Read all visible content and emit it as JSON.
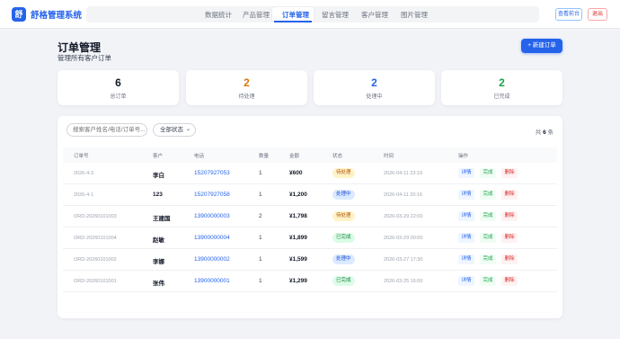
{
  "app": {
    "logo": "舒",
    "title": "舒格管理系统"
  },
  "nav": {
    "tabs": [
      "数据统计",
      "产品管理",
      "订单管理",
      "留言管理",
      "客户管理",
      "图片管理"
    ],
    "active_index": 2
  },
  "header_buttons": {
    "frontend": "查看前台",
    "logout": "退出"
  },
  "page": {
    "title": "订单管理",
    "subtitle": "管理所有客户订单",
    "new_button": "+ 新建订单"
  },
  "stats": [
    {
      "value": "6",
      "label": "总订单",
      "color": "#111827"
    },
    {
      "value": "2",
      "label": "待处理",
      "color": "#d97706"
    },
    {
      "value": "2",
      "label": "处理中",
      "color": "#2563eb"
    },
    {
      "value": "2",
      "label": "已完成",
      "color": "#16a34a"
    }
  ],
  "filters": {
    "search_placeholder": "搜索客户姓名/电话/订单号...",
    "status_select": "全部状态"
  },
  "count": {
    "prefix": "共",
    "number": "6",
    "suffix": "条"
  },
  "table": {
    "columns": [
      "订单号",
      "客户",
      "电话",
      "数量",
      "金额",
      "状态",
      "时间",
      "操作"
    ],
    "rows": [
      {
        "order_no": "2026-4-3",
        "customer": "李白",
        "phone": "15207927053",
        "qty": "1",
        "amount": "¥600",
        "status": "待处理",
        "status_color": "amber",
        "time": "2026-04-11 23:19"
      },
      {
        "order_no": "2026-4-1",
        "customer": "123",
        "phone": "15207927058",
        "qty": "1",
        "amount": "¥1,200",
        "status": "处理中",
        "status_color": "blue",
        "time": "2026-04-11 20:16"
      },
      {
        "order_no": "ORD-20260101003",
        "customer": "王建国",
        "phone": "13900000003",
        "qty": "2",
        "amount": "¥1,798",
        "status": "待处理",
        "status_color": "amber",
        "time": "2026-03-29 22:00"
      },
      {
        "order_no": "ORD-20260101004",
        "customer": "赵敏",
        "phone": "13900000004",
        "qty": "1",
        "amount": "¥1,899",
        "status": "已完成",
        "status_color": "green",
        "time": "2026-03-29 00:00"
      },
      {
        "order_no": "ORD-20260101002",
        "customer": "李娜",
        "phone": "13900000002",
        "qty": "1",
        "amount": "¥1,599",
        "status": "处理中",
        "status_color": "blue",
        "time": "2026-03-27 17:30"
      },
      {
        "order_no": "ORD-20260101001",
        "customer": "张伟",
        "phone": "13900000001",
        "qty": "1",
        "amount": "¥1,299",
        "status": "已完成",
        "status_color": "green",
        "time": "2026-03-25 16:00"
      }
    ],
    "actions": {
      "detail": "详情",
      "done": "完成",
      "delete": "删除"
    }
  },
  "colors": {
    "accent": "#2563eb",
    "amber_bg": "#fef3c7",
    "amber_fg": "#b45309",
    "blue_bg": "#dbeafe",
    "blue_fg": "#1d4ed8",
    "green_bg": "#dcfce7",
    "green_fg": "#15803d"
  }
}
